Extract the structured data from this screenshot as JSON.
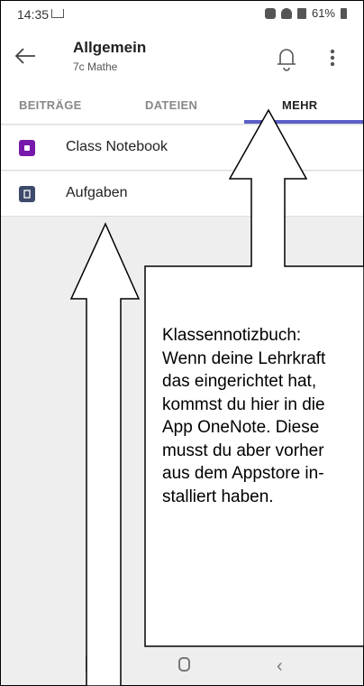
{
  "status_bar": {
    "time": "14:35",
    "battery": "61%"
  },
  "app_bar": {
    "title": "Allgemein",
    "subtitle": "7c Mathe"
  },
  "tabs": [
    {
      "label": "BEITRÄGE"
    },
    {
      "label": "DATEIEN"
    },
    {
      "label": "MEHR"
    }
  ],
  "list": [
    {
      "label": "Class Notebook",
      "icon": "onenote-icon",
      "color": "#7719aa"
    },
    {
      "label": "Aufgaben",
      "icon": "assignments-icon",
      "color": "#3d4a6b"
    }
  ],
  "annotation": {
    "text": "Klassennotizbuch:\nWenn deine Lehrkraft\ndas eingerichtet hat,\nkommst du hier in die\nApp OneNote. Diese\nmusst du aber vorher\naus dem Appstore in-\nstalliert haben."
  },
  "colors": {
    "accent": "#5b5fc7"
  }
}
